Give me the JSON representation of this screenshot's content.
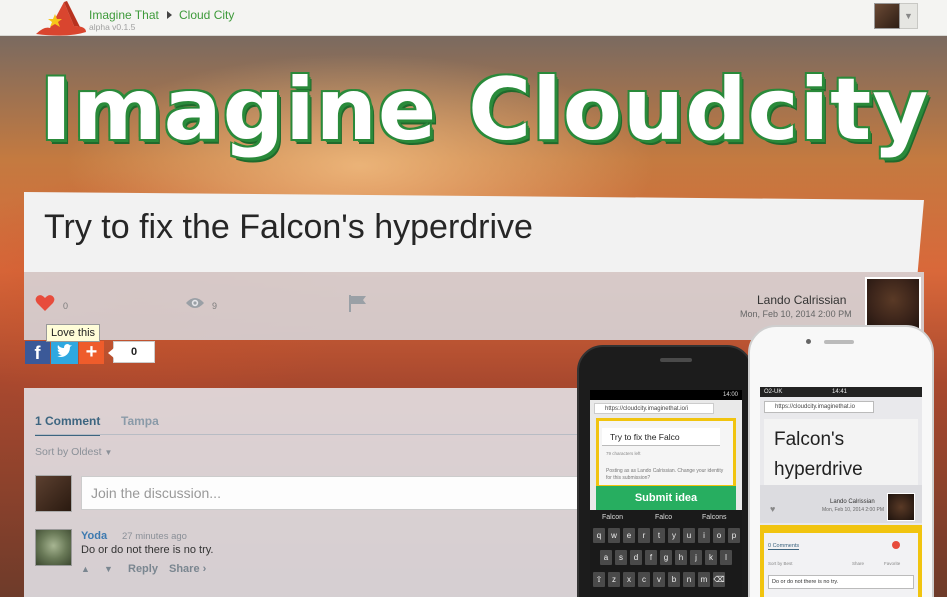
{
  "nav": {
    "brand": "Imagine That",
    "version": "alpha v0.1.5",
    "breadcrumb": "Cloud City"
  },
  "hero": {
    "title": "Imagine Cloudcity"
  },
  "idea": {
    "title": "Try to fix the Falcon's hyperdrive",
    "love_count": "0",
    "view_count": "9",
    "love_tooltip": "Love this",
    "author": "Lando Calrissian",
    "date": "Mon, Feb 10, 2014 2:00 PM"
  },
  "share": {
    "count": "0"
  },
  "comments": {
    "tab_comments": "1 Comment",
    "tab_community": "Tampa",
    "sort": "Sort by Oldest",
    "input_placeholder": "Join the discussion...",
    "items": [
      {
        "author": "Yoda",
        "time": "27 minutes ago",
        "text": "Do or do not there is no try.",
        "reply": "Reply",
        "share": "Share ›"
      }
    ]
  },
  "android": {
    "status_time": "14:00",
    "url": "https://cloudcity.imaginethat.io/i",
    "input_value": "Try to fix the Falco",
    "chars_left": "79 characters left",
    "posting_as": "Posting as as Lando Calrissian. Change your identity for this submission?",
    "submit": "Submit idea",
    "suggestions": [
      "Falcon",
      "Falco",
      "Falcons"
    ],
    "keys_row1": [
      "q",
      "w",
      "e",
      "r",
      "t",
      "y",
      "u",
      "i",
      "o",
      "p"
    ],
    "keys_row2": [
      "a",
      "s",
      "d",
      "f",
      "g",
      "h",
      "j",
      "k",
      "l"
    ],
    "keys_row3": [
      "⇧",
      "z",
      "x",
      "c",
      "v",
      "b",
      "n",
      "m",
      "⌫"
    ]
  },
  "iphone": {
    "carrier": "O2-UK",
    "time": "14:41",
    "url": "https://cloudcity.imaginethat.io",
    "title": "Falcon's hyperdrive",
    "author": "Lando Calrissian",
    "date": "Mon, Feb 10, 2014 2:00 PM",
    "comments_tab": "0 Comments",
    "sort": "Sort by Best",
    "share": "Share",
    "favorite": "Favorite",
    "input_value": "Do or do not there is no try."
  },
  "colors": {
    "brand_green": "#3d9a3a",
    "heart_red": "#e74c3c",
    "link_blue": "#3d6580",
    "submit_green": "#27ae60",
    "accent_yellow": "#f1c40f"
  }
}
